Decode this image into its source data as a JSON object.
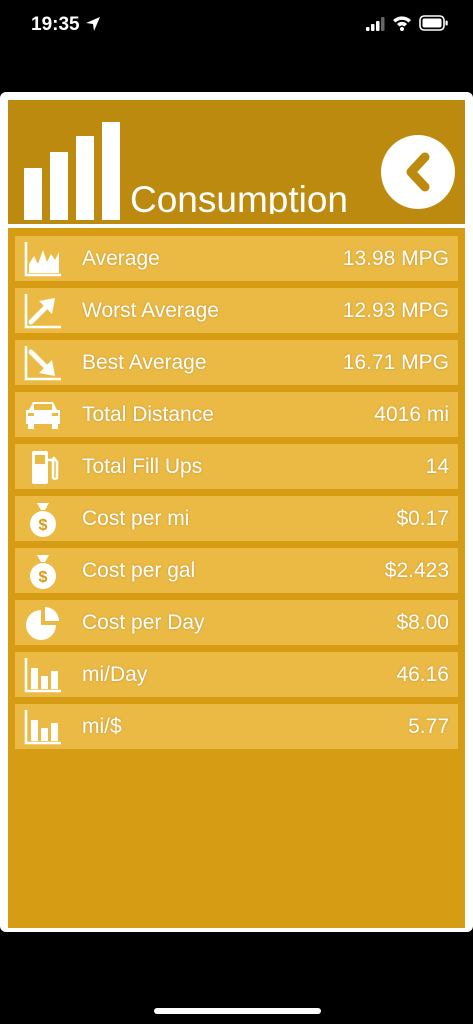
{
  "status_bar": {
    "time": "19:35"
  },
  "header": {
    "title": "Consumption",
    "colors": {
      "header_bg": "#bd8a10",
      "panel_bg": "#d69c14",
      "row_bg": "#ebba45"
    }
  },
  "stats": [
    {
      "icon": "area-chart-icon",
      "label": "Average",
      "value": "13.98 MPG"
    },
    {
      "icon": "trend-up-icon",
      "label": "Worst Average",
      "value": "12.93 MPG"
    },
    {
      "icon": "trend-down-icon",
      "label": "Best Average",
      "value": "16.71 MPG"
    },
    {
      "icon": "car-icon",
      "label": "Total Distance",
      "value": "4016 mi"
    },
    {
      "icon": "fuel-pump-icon",
      "label": "Total Fill Ups",
      "value": "14"
    },
    {
      "icon": "money-bag-icon",
      "label": "Cost per mi",
      "value": "$0.17"
    },
    {
      "icon": "money-bag-icon",
      "label": "Cost per gal",
      "value": "$2.423"
    },
    {
      "icon": "pie-chart-icon",
      "label": "Cost per Day",
      "value": "$8.00"
    },
    {
      "icon": "bar-chart-icon",
      "label": " mi/Day",
      "value": "46.16"
    },
    {
      "icon": "bar-chart-icon",
      "label": " mi/$",
      "value": "5.77"
    }
  ]
}
